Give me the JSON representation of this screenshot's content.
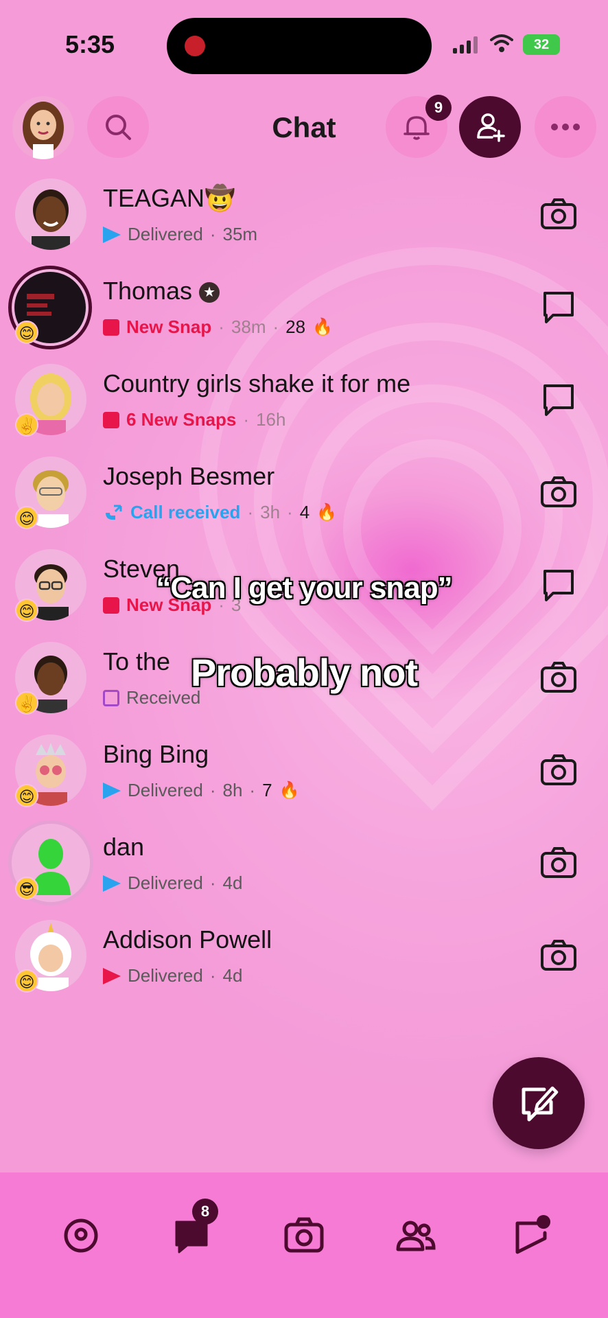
{
  "status_bar": {
    "time": "5:35",
    "battery": "32"
  },
  "header": {
    "title": "Chat",
    "notification_count": "9"
  },
  "chats": [
    {
      "name": "TEAGAN🤠",
      "status": "Delivered",
      "time": "35m",
      "streak": "",
      "status_kind": "delivered",
      "action": "camera",
      "badge": ""
    },
    {
      "name": "Thomas",
      "status": "New Snap",
      "time": "38m",
      "streak": "28",
      "status_kind": "new",
      "action": "chat",
      "badge": "😊"
    },
    {
      "name": "Country girls shake it for me",
      "status": "6 New Snaps",
      "time": "16h",
      "streak": "",
      "status_kind": "new",
      "action": "chat",
      "badge": "✌️"
    },
    {
      "name": "Joseph Besmer",
      "status": "Call received",
      "time": "3h",
      "streak": "4",
      "status_kind": "call",
      "action": "camera",
      "badge": "😊"
    },
    {
      "name": "Steven",
      "status": "New Snap",
      "time": "3",
      "streak": "",
      "status_kind": "new",
      "action": "chat",
      "badge": "😊"
    },
    {
      "name": "To the",
      "status": "Received",
      "time": "",
      "streak": "",
      "status_kind": "received",
      "action": "camera",
      "badge": "✌️"
    },
    {
      "name": "Bing Bing",
      "status": "Delivered",
      "time": "8h",
      "streak": "7",
      "status_kind": "delivered",
      "action": "camera",
      "badge": "😊"
    },
    {
      "name": "dan",
      "status": "Delivered",
      "time": "4d",
      "streak": "",
      "status_kind": "delivered",
      "action": "camera",
      "badge": "😎"
    },
    {
      "name": "Addison Powell",
      "status": "Delivered",
      "time": "4d",
      "streak": "",
      "status_kind": "delivered-red",
      "action": "camera",
      "badge": "😊"
    }
  ],
  "captions": {
    "line1": "“Can I get your snap”",
    "line2": "Probably not"
  },
  "tabbar": {
    "chat_badge": "8"
  },
  "colors": {
    "accent": "#4b0a2e",
    "new_snap": "#e8154a",
    "delivered": "#2aa3ef",
    "background": "#f49bd8"
  }
}
